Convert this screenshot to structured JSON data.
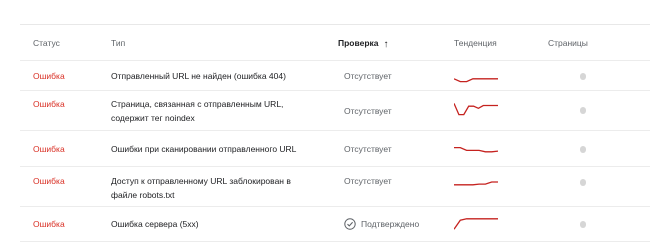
{
  "columns": {
    "status": "Статус",
    "type": "Тип",
    "check": "Проверка",
    "trend": "Тенденция",
    "pages": "Страницы"
  },
  "sort_icon": "arrow-upward-icon",
  "status_color": "#d93025",
  "trend_color": "#c5221f",
  "rows": [
    {
      "status": "Ошибка",
      "type_lines": [
        "Отправленный URL не найден (ошибка 404)"
      ],
      "check": "Отсутствует",
      "check_icon": null,
      "trend": [
        0.3,
        0.1,
        0.1,
        0.3,
        0.3,
        0.3,
        0.3,
        0.3
      ]
    },
    {
      "status": "Ошибка",
      "type_lines": [
        "Страница, связанная с отправленным URL,",
        "содержит тег noindex"
      ],
      "check": "Отсутствует",
      "check_icon": null,
      "trend": [
        0.9,
        0.1,
        0.1,
        0.7,
        0.7,
        0.55,
        0.75,
        0.75,
        0.75,
        0.75
      ]
    },
    {
      "status": "Ошибка",
      "type_lines": [
        "Ошибки при сканировании отправленного URL"
      ],
      "check": "Отсутствует",
      "check_icon": null,
      "trend": [
        0.6,
        0.6,
        0.4,
        0.4,
        0.4,
        0.3,
        0.3,
        0.35
      ]
    },
    {
      "status": "Ошибка",
      "type_lines": [
        "Доступ к отправленному URL заблокирован в",
        "файле robots.txt"
      ],
      "check": "Отсутствует",
      "check_icon": null,
      "trend": [
        0.3,
        0.3,
        0.3,
        0.3,
        0.35,
        0.35,
        0.5,
        0.5
      ]
    },
    {
      "status": "Ошибка",
      "type_lines": [
        "Ошибка сервера (5xx)"
      ],
      "check": "Подтверждено",
      "check_icon": "check-circle-icon",
      "trend": [
        0.05,
        0.7,
        0.8,
        0.8,
        0.8,
        0.8,
        0.8,
        0.8
      ]
    }
  ]
}
